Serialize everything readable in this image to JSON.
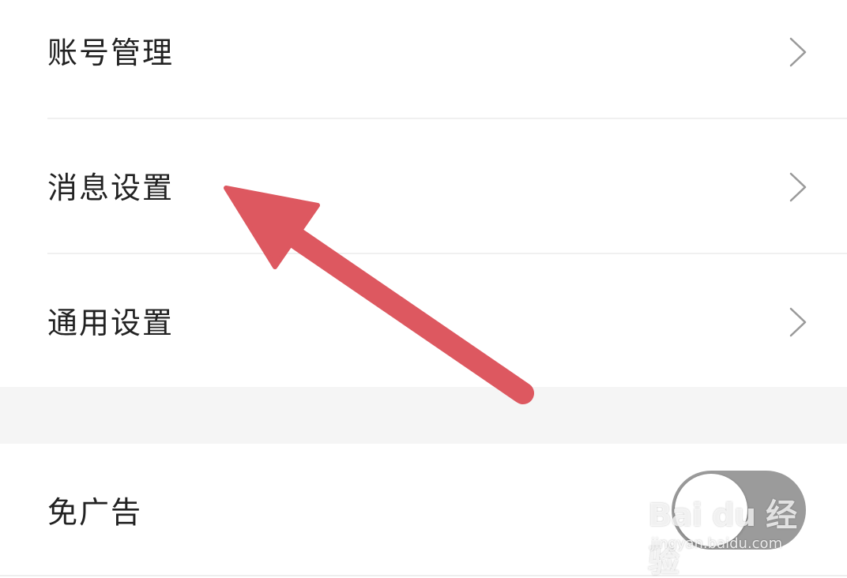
{
  "settings": {
    "items": [
      {
        "label": "账号管理",
        "icon": "chevron-right-icon"
      },
      {
        "label": "消息设置",
        "icon": "chevron-right-icon"
      },
      {
        "label": "通用设置",
        "icon": "chevron-right-icon"
      }
    ],
    "ad_free": {
      "label": "免广告",
      "enabled": false
    }
  },
  "watermark": {
    "brand": "Bai du 经验",
    "url": "jingyan.baidu.com"
  },
  "colors": {
    "annotation_arrow": "#dd5860",
    "toggle_off": "#9b9b9b",
    "section_gap": "#f5f5f5",
    "text": "#222222",
    "chevron": "#9a9a9a"
  }
}
